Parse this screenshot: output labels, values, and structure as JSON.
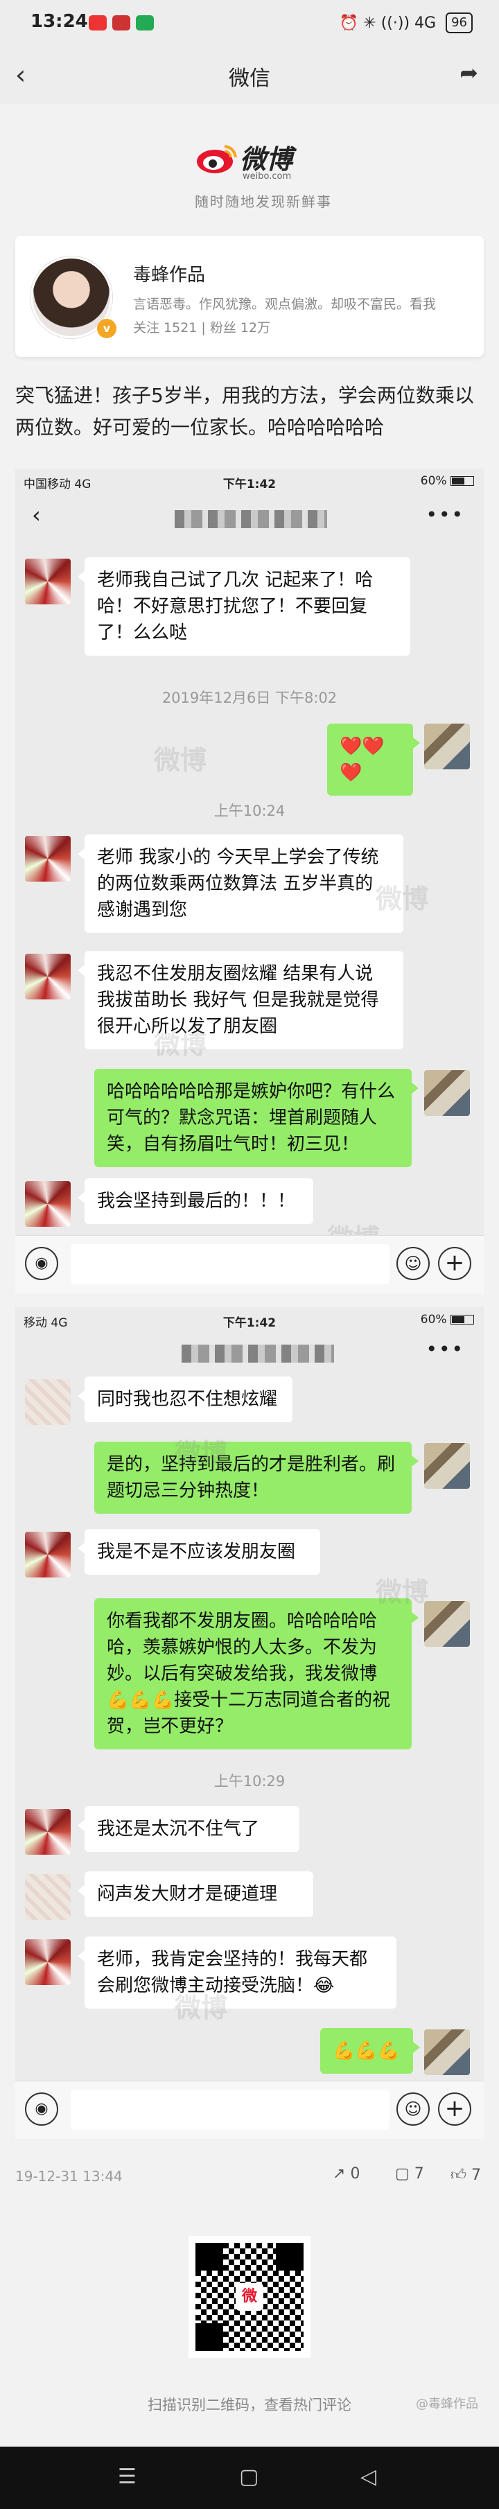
{
  "status_bar": {
    "time": "13:24",
    "right": "⏰ ✳ ((·)) 4G",
    "battery": "96"
  },
  "nav": {
    "title": "微信",
    "back_icon": "back-chevron-icon",
    "share_icon": "share-icon"
  },
  "logo": {
    "brand": "微博",
    "url": "weibo.com",
    "slogan": "随时随地发现新鲜事"
  },
  "profile": {
    "name": "毒蜂作品",
    "description": "言语恶毒。作风犹豫。观点偏激。却吸不富民。看我",
    "stats": "关注 1521 | 粉丝 12万",
    "verified": "v"
  },
  "post_text": "突飞猛进！孩子5岁半，用我的方法，学会两位数乘以两位数。好可爱的一位家长。哈哈哈哈哈哈",
  "shot1": {
    "status_left": "中国移动 4G",
    "status_time": "下午1:42",
    "status_right": "60%",
    "messages": [
      {
        "side": "left",
        "text": "老师我自己试了几次 记起来了！哈哈！不好意思打扰您了！不要回复了！么么哒"
      },
      {
        "type": "time",
        "text": "2019年12月6日 下午8:02"
      },
      {
        "side": "right",
        "text": "❤️❤️❤️"
      },
      {
        "type": "time",
        "text": "上午10:24"
      },
      {
        "side": "left",
        "text": "老师 我家小的 今天早上学会了传统的两位数乘两位数算法 五岁半真的感谢遇到您"
      },
      {
        "side": "left",
        "text": "我忍不住发朋友圈炫耀 结果有人说我拔苗助长 我好气 但是我就是觉得很开心所以发了朋友圈"
      },
      {
        "side": "right",
        "text": "哈哈哈哈哈哈那是嫉妒你吧？有什么可气的？默念咒语：埋首刷题随人笑，自有扬眉吐气时！初三见！"
      },
      {
        "side": "left",
        "text": "我会坚持到最后的！！！"
      }
    ]
  },
  "shot2": {
    "status_left": "移动 4G",
    "status_time": "下午1:42",
    "status_right": "60%",
    "messages": [
      {
        "side": "left",
        "text": "同时我也忍不住想炫耀"
      },
      {
        "side": "right",
        "text": "是的，坚持到最后的才是胜利者。刷题切忌三分钟热度！"
      },
      {
        "side": "left",
        "text": "我是不是不应该发朋友圈"
      },
      {
        "side": "right",
        "text": "你看我都不发朋友圈。哈哈哈哈哈哈，羡慕嫉妒恨的人太多。不发为妙。以后有突破发给我，我发微博💪💪💪接受十二万志同道合者的祝贺，岂不更好？"
      },
      {
        "type": "time",
        "text": "上午10:29"
      },
      {
        "side": "left",
        "text": "我还是太沉不住气了"
      },
      {
        "side": "left",
        "text": "闷声发大财才是硬道理"
      },
      {
        "side": "left",
        "text": "老师，我肯定会坚持的！我每天都会刷您微博主动接受洗脑！😂"
      },
      {
        "side": "right",
        "text": "💪💪💪"
      }
    ]
  },
  "footer": {
    "date": "19-12-31 13:44",
    "reposts": "0",
    "comments": "7",
    "likes": "7",
    "qr_caption": "扫描识别二维码，查看热门评论",
    "qr_logo": "微"
  },
  "watermark": "@毒蜂作品",
  "chat_watermark": "微博"
}
